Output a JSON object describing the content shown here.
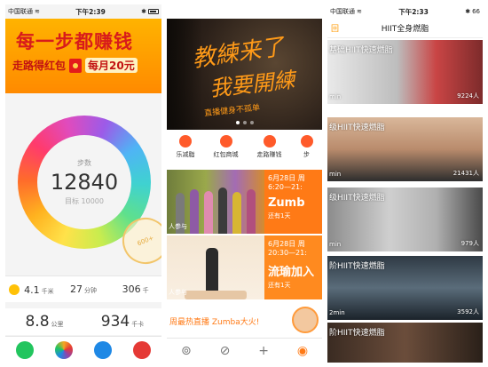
{
  "screen1": {
    "status": {
      "carrier": "中国联通",
      "time": "下午2:39",
      "battery": ""
    },
    "banner": {
      "line1": "每一步都赚钱",
      "line2_a": "走路得红包",
      "line2_b": "每月20元"
    },
    "ring": {
      "label": "步数",
      "steps": "12840",
      "goal": "目标 10000"
    },
    "stamp": "600+",
    "stats": [
      {
        "value": "4.1",
        "unit": "千米"
      },
      {
        "value": "27",
        "unit": "分钟"
      },
      {
        "value": "306",
        "unit": "千"
      }
    ],
    "stats2": [
      {
        "value": "8.8",
        "unit": "公里"
      },
      {
        "value": "934",
        "unit": "千卡"
      }
    ],
    "tab_colors": [
      "#22c55e",
      "#f5a623",
      "#1e88e5",
      "#e53935"
    ]
  },
  "screen2": {
    "status": {
      "carrier": "中国联通",
      "time": "下午2:33",
      "battery": "66"
    },
    "hero": {
      "t1": "教練来了",
      "t2": "我要開練",
      "t3": "直播健身不孤单"
    },
    "menu": [
      "乐减脂",
      "红包商城",
      "走路赚钱",
      "步"
    ],
    "cards": [
      {
        "date": "6月28日 周",
        "time": "6:20—21:",
        "title": "Zumb",
        "remain": "还有1天",
        "join": "人参与"
      },
      {
        "date": "6月28日 周",
        "time": "20:30—21:",
        "title": "流瑜加入",
        "remain": "还有1天",
        "join": "人参与"
      }
    ],
    "promo": "周最热直播  Zumba大火!",
    "tabs": [
      "⊚",
      "⊘",
      "+",
      "◉"
    ]
  },
  "screen3": {
    "status": {
      "carrier": "中国联通",
      "time": "下午2:33",
      "battery": "66"
    },
    "nav_title": "HIIT全身燃脂",
    "back": "回",
    "rows": [
      {
        "title": "基础HIIT快速燃脂",
        "duration": "min",
        "count": "9224人"
      },
      {
        "title": "级HIIT快速燃脂",
        "duration": "min",
        "count": "21431人"
      },
      {
        "title": "级HIIT快速燃脂",
        "duration": "min",
        "count": "979人"
      },
      {
        "title": "阶HIIT快速燃脂",
        "duration": "2min",
        "count": "3592人"
      },
      {
        "title": "阶HIIT快速燃脂",
        "duration": "",
        "count": ""
      }
    ]
  }
}
